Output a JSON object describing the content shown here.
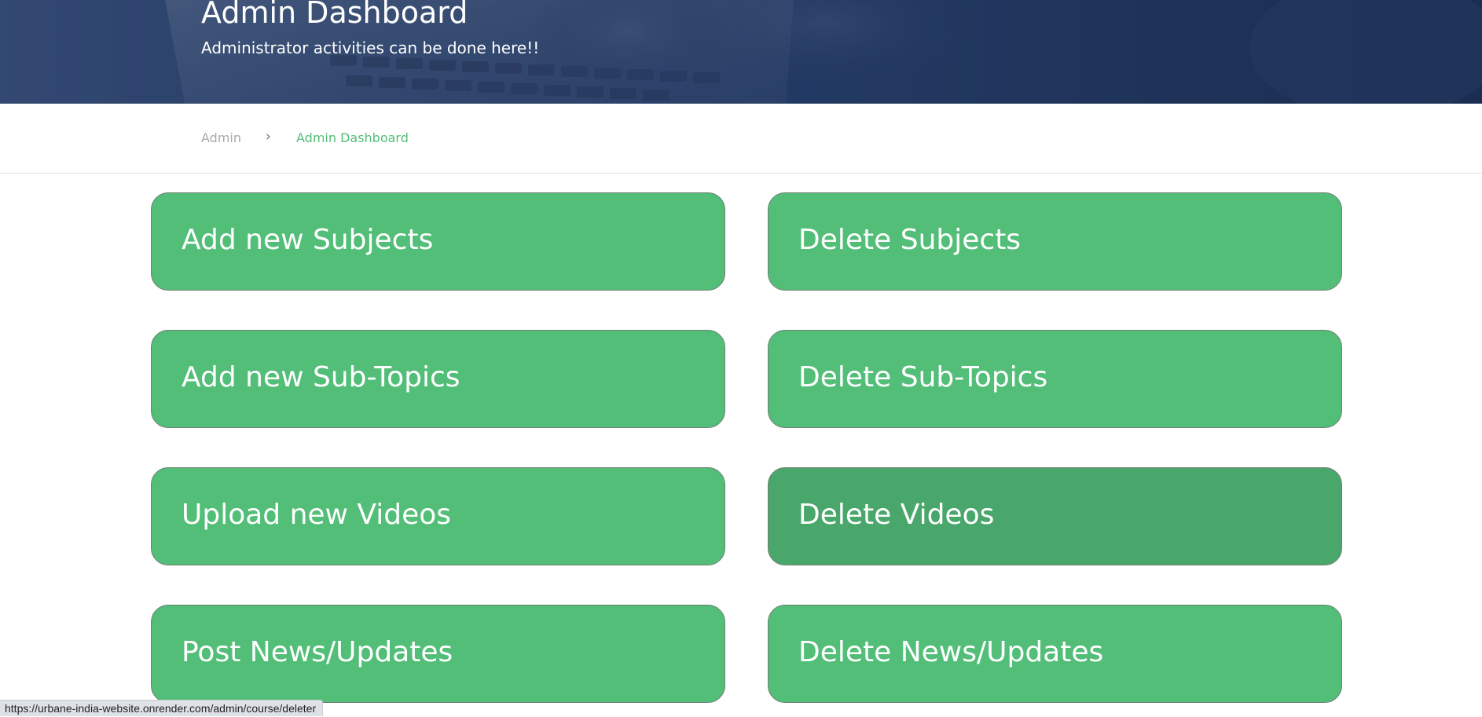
{
  "header": {
    "title": "Admin Dashboard",
    "subtitle": "Administrator activities can be done here!!"
  },
  "breadcrumb": {
    "items": [
      {
        "label": "Admin"
      },
      {
        "separator": "›"
      },
      {
        "label": "Admin Dashboard"
      }
    ]
  },
  "actions": [
    {
      "label": "Add new Subjects"
    },
    {
      "label": "Delete Subjects"
    },
    {
      "label": "Add new Sub-Topics"
    },
    {
      "label": "Delete Sub-Topics"
    },
    {
      "label": "Upload new Videos"
    },
    {
      "label": "Delete Videos",
      "state": "hovered"
    },
    {
      "label": "Post News/Updates"
    },
    {
      "label": "Delete News/Updates"
    }
  ],
  "status_bar": {
    "url": "https://urbane-india-website.onrender.com/admin/course/deleter"
  },
  "colors": {
    "tile": "#52be78",
    "tile_hover": "#4aa76b",
    "breadcrumb_active": "#52bd77",
    "hero": "#28416b"
  }
}
